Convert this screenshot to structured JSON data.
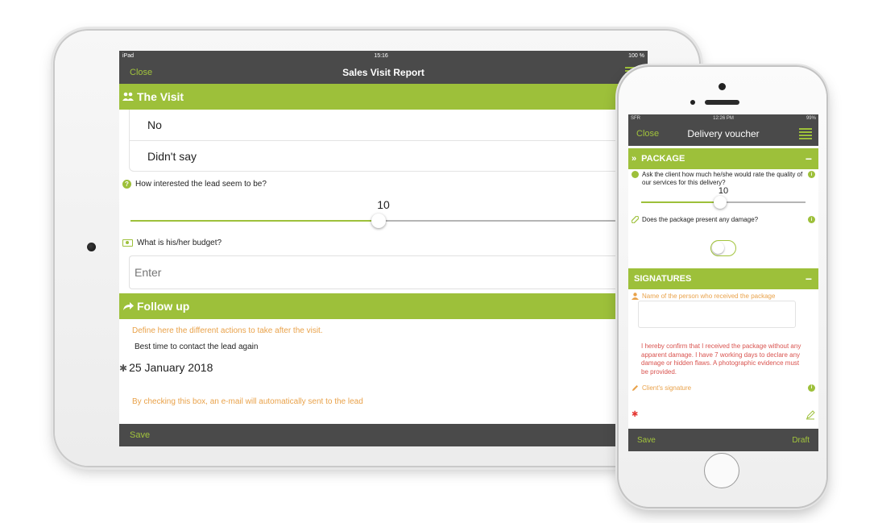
{
  "colors": {
    "accent": "#9dc03a",
    "bar": "#4a4a4a",
    "hint": "#e9a24a",
    "warning": "#d9534f"
  },
  "tablet": {
    "status": {
      "device": "iPad",
      "time": "15:16",
      "battery": "100 %"
    },
    "nav": {
      "close_label": "Close",
      "title": "Sales Visit Report"
    },
    "visit": {
      "title": "The Visit",
      "options": [
        "No",
        "Didn't say"
      ],
      "interest_question": "How interested the lead seem to be?",
      "interest_value": "10",
      "interest_fraction": 0.48,
      "budget_question": "What is his/her budget?",
      "budget_placeholder": "Enter"
    },
    "follow_up": {
      "title": "Follow up",
      "hint": "Define here the different actions to take after the visit.",
      "contact_label": "Best time to contact the lead again",
      "contact_date": "25 January 2018",
      "email_hint": "By checking this box, an e-mail will automatically sent to the lead"
    },
    "toolbar": {
      "save_label": "Save"
    }
  },
  "phone": {
    "status": {
      "carrier": "SFR",
      "time": "12:26 PM",
      "battery": "99%"
    },
    "nav": {
      "close_label": "Close",
      "title": "Delivery voucher"
    },
    "package": {
      "title": "PACKAGE",
      "rating_question": "Ask the client how much he/she would rate the quality of our services for this delivery?",
      "rating_value": "10",
      "rating_fraction": 0.48,
      "damage_question": "Does the package present any damage?",
      "damage_toggle_on": false
    },
    "signatures": {
      "title": "SIGNATURES",
      "receiver_label": "Name of the person who received the package",
      "confirmation": "I hereby confirm that I received the package without any apparent damage. I have 7 working days to declare any damage or hidden flaws. A photographic evidence must be provided.",
      "signature_label": "Client's signature"
    },
    "toolbar": {
      "save_label": "Save",
      "draft_label": "Draft"
    }
  }
}
